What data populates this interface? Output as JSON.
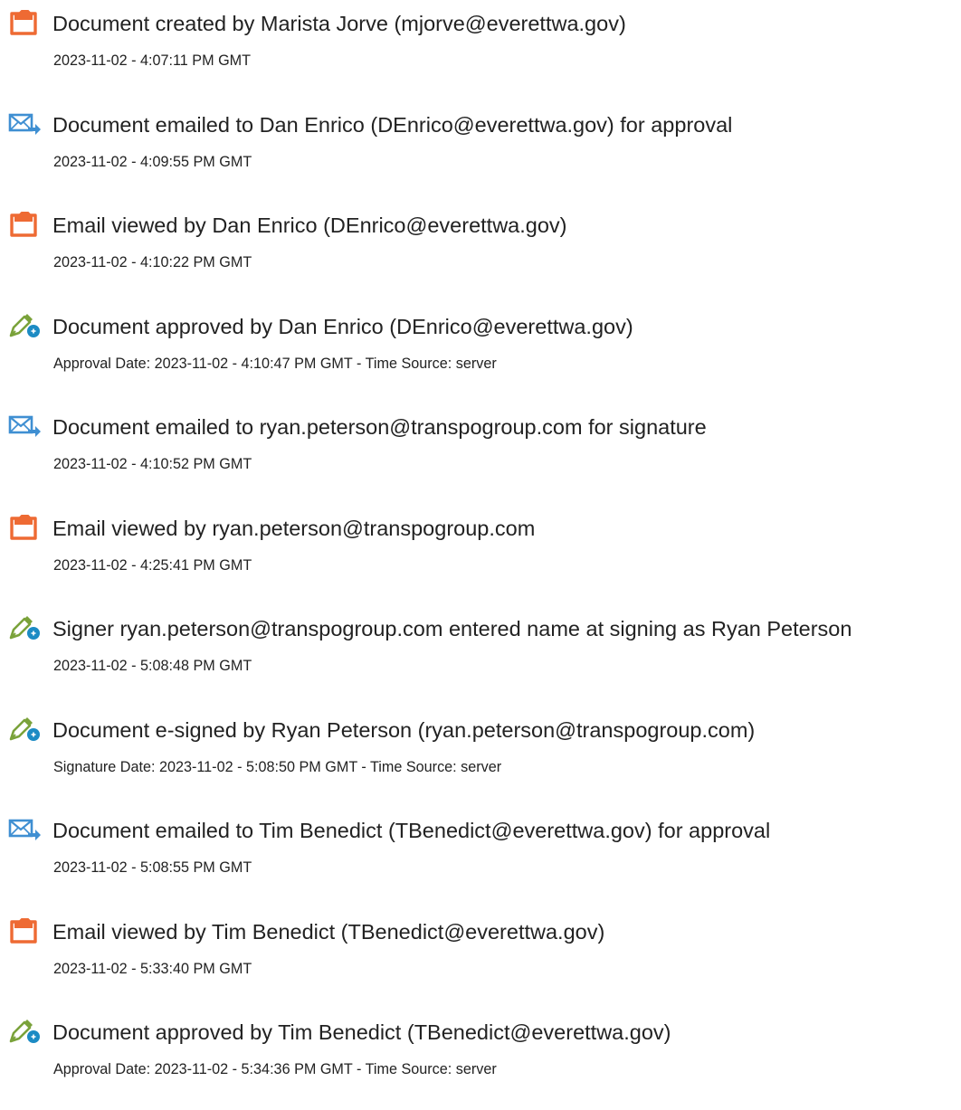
{
  "colors": {
    "doc_icon": "#ee6a33",
    "email_icon": "#3f8fd2",
    "sign_icon": "#7aa23a",
    "sign_badge": "#1c8bc4",
    "text": "#222222"
  },
  "events": [
    {
      "icon": "document-icon",
      "title": "Document created by Marista Jorve (mjorve@everettwa.gov)",
      "detail": "2023-11-02 - 4:07:11 PM GMT"
    },
    {
      "icon": "email-icon",
      "title": "Document emailed to Dan Enrico (DEnrico@everettwa.gov) for approval",
      "detail": "2023-11-02 - 4:09:55 PM GMT"
    },
    {
      "icon": "document-icon",
      "title": "Email viewed by Dan Enrico (DEnrico@everettwa.gov)",
      "detail": "2023-11-02 - 4:10:22 PM GMT"
    },
    {
      "icon": "pen-icon",
      "title": "Document approved by Dan Enrico (DEnrico@everettwa.gov)",
      "detail": "Approval Date: 2023-11-02 - 4:10:47 PM GMT - Time Source: server"
    },
    {
      "icon": "email-icon",
      "title": "Document emailed to ryan.peterson@transpogroup.com for signature",
      "detail": "2023-11-02 - 4:10:52 PM GMT"
    },
    {
      "icon": "document-icon",
      "title": "Email viewed by ryan.peterson@transpogroup.com",
      "detail": "2023-11-02 - 4:25:41 PM GMT"
    },
    {
      "icon": "pen-icon",
      "title": "Signer ryan.peterson@transpogroup.com entered name at signing as Ryan Peterson",
      "detail": "2023-11-02 - 5:08:48 PM GMT"
    },
    {
      "icon": "pen-icon",
      "title": "Document e-signed by Ryan Peterson (ryan.peterson@transpogroup.com)",
      "detail": "Signature Date: 2023-11-02 - 5:08:50 PM GMT - Time Source: server"
    },
    {
      "icon": "email-icon",
      "title": "Document emailed to Tim Benedict (TBenedict@everettwa.gov) for approval",
      "detail": "2023-11-02 - 5:08:55 PM GMT"
    },
    {
      "icon": "document-icon",
      "title": "Email viewed by Tim Benedict (TBenedict@everettwa.gov)",
      "detail": "2023-11-02 - 5:33:40 PM GMT"
    },
    {
      "icon": "pen-icon",
      "title": "Document approved by Tim Benedict (TBenedict@everettwa.gov)",
      "detail": "Approval Date: 2023-11-02 - 5:34:36 PM GMT - Time Source: server"
    }
  ]
}
